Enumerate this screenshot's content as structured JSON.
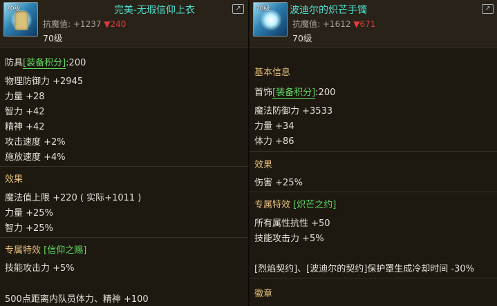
{
  "left": {
    "icon_level": "70级",
    "title": "完美-无瑕信仰上衣",
    "resist_label": "抗魔值:",
    "resist_value": "+1237",
    "resist_diff": "▼240",
    "level": "70级",
    "category": "防具",
    "score_tag": "[装备积分]",
    "score_value": ":200",
    "stats": [
      "物理防御力 +2945",
      "力量 +28",
      "智力 +42",
      "精神 +42",
      "攻击速度 +2%",
      "施放速度 +4%"
    ],
    "effect_heading": "效果",
    "effects": [
      "魔法值上限 +220 ( 实际+1011 )",
      "力量 +25%",
      "智力 +25%"
    ],
    "special_heading": "专属特效",
    "special_tag": "[信仰之赐]",
    "special_stats": [
      "技能攻击力 +5%"
    ],
    "footer": "500点距离内队员体力、精神 +100"
  },
  "right": {
    "icon_level": "70级",
    "title": "波迪尔的炽芒手镯",
    "resist_label": "抗魔值:",
    "resist_value": "+1612",
    "resist_diff": "▼671",
    "level": "70级",
    "basic_heading": "基本信息",
    "category": "首饰",
    "score_tag": "[装备积分]",
    "score_value": ":200",
    "stats": [
      "魔法防御力 +3533",
      "力量 +34",
      "体力 +86"
    ],
    "effect_heading": "效果",
    "effects": [
      "伤害 +25%"
    ],
    "special_heading": "专属特效",
    "special_tag": "[炽芒之约]",
    "special_stats": [
      "所有属性抗性 +50",
      "技能攻击力 +5%"
    ],
    "set_note": "[烈焰契约]、[波迪尔的契约]保护罩生成冷却时间 -30%",
    "emblem_heading": "徽章"
  },
  "colors": {
    "title": "#4fe0cf",
    "heading": "#e6c07a",
    "tag": "#5fdb5f",
    "down_red": "#e53b3b"
  }
}
